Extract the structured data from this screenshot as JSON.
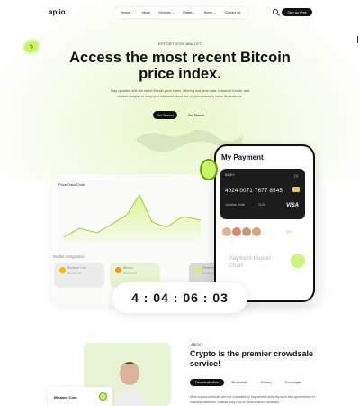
{
  "nav": {
    "logo": "aplio",
    "items": [
      "Home ⌄",
      "About",
      "Services ⌄",
      "Pages ⌄",
      "Home ⌄",
      "Contact Us"
    ],
    "signup": "Sign Up Free"
  },
  "hero": {
    "eyebrow": "EFFORTLESS WALLET",
    "title_line1": "Access the most recent Bitcoin",
    "title_line2": "price index.",
    "subtitle": "Stay updated with the latest Bitcoin price index, offering real-time data, historical trends, and market insights to keep you informed about the cryptocurrency's value fluctuations.",
    "btn_primary": "Get Started",
    "btn_secondary": "Get Started"
  },
  "dashboard": {
    "chart_title": "Price Data Chart",
    "wallet_title": "Wallet Integration",
    "wallets": [
      {
        "name": "Binance Coin",
        "value": "$4,420.00"
      },
      {
        "name": "Bitcoin",
        "value": "$4,420.00"
      },
      {
        "name": "Ethereum",
        "value": "$4,420.00"
      }
    ]
  },
  "phone": {
    "title": "My Payment",
    "bank_name": "BANKY",
    "card_number": "4024 0071 7677 8545",
    "card_holder": "Jonathan Smith",
    "card_expiry": "01/25",
    "card_brand": "VISA",
    "online_label": "20+",
    "report": "Payment Report Chart"
  },
  "timer": "4 : 04 : 06 : 03",
  "about": {
    "label": "ABOUT",
    "title": "Crypto is the premier crowdsale service!",
    "tabs": [
      "Decentralization",
      "Blockchain",
      "Privacy",
      "Exchanges"
    ],
    "paragraph": "Most cryptocurrencies are not controlled by any central authority such as a government or financial institution. Instead, they rely on decentralized networks",
    "coin_label": "Binance Coin"
  },
  "colors": {
    "accent": "#c8f46a",
    "dark": "#111111"
  }
}
